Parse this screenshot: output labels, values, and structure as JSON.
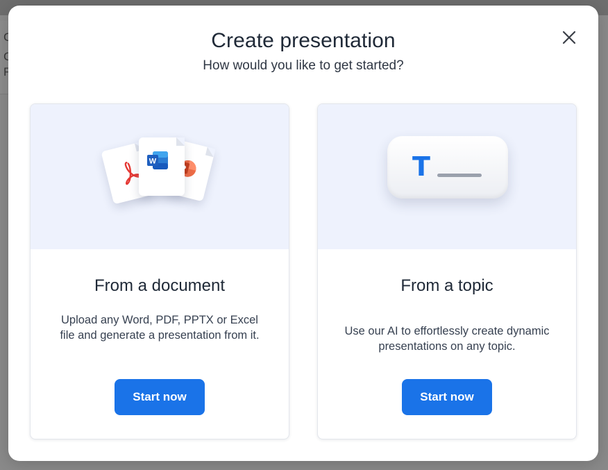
{
  "background": {
    "peek_text": [
      "C",
      "C",
      "F"
    ]
  },
  "modal": {
    "title": "Create presentation",
    "subtitle": "How would you like to get started?",
    "close_icon": "close-icon"
  },
  "options": [
    {
      "title": "From a document",
      "description": "Upload any Word, PDF, PPTX or Excel file and generate a presentation from it.",
      "button_label": "Start now",
      "icons": [
        "pdf-icon",
        "word-icon",
        "powerpoint-icon"
      ]
    },
    {
      "title": "From a topic",
      "description": "Use our AI to effortlessly create dynamic presentations on any topic.",
      "button_label": "Start now",
      "illustration_letter": "T",
      "icons": [
        "text-input-icon"
      ]
    }
  ],
  "colors": {
    "primary": "#1a73e8",
    "illustration_bg": "#eef2fd",
    "pdf_red": "#e53935",
    "word_blue": "#1f5fbf",
    "ppt_orange": "#d35230"
  }
}
